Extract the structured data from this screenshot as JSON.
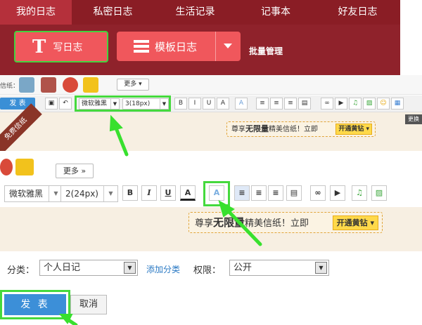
{
  "nav": {
    "tabs": [
      "我的日志",
      "私密日志",
      "生活记录",
      "记事本",
      "好友日志"
    ]
  },
  "actions": {
    "write": "写日志",
    "write_icon_glyph": "T",
    "template": "模板日志",
    "batch": "批量管理"
  },
  "small_editor": {
    "sticker_label": "信纸：",
    "more": "更多 ▾",
    "send": "发 表",
    "font": "微软雅黑",
    "size": "3(18px)",
    "format_glyphs": [
      "B",
      "I",
      "U",
      "A"
    ],
    "stamp": "免费信纸",
    "change": "更换",
    "promo_pre": "尊享",
    "promo_bold": "无限量",
    "promo_post": "精美信纸！立即",
    "vip": "开通黄钻 ▾"
  },
  "big_editor": {
    "more": "更多 »",
    "font": "微软雅黑",
    "size": "2(24px)",
    "format_glyphs": [
      "B",
      "I",
      "U",
      "A",
      "A"
    ],
    "promo_pre": "尊享",
    "promo_bold": "无限量",
    "promo_post": "精美信纸！立即",
    "vip": "开通黄钻 ▾"
  },
  "form": {
    "category_label": "分类：",
    "category_value": "个人日记",
    "add_category": "添加分类",
    "permission_label": "权限：",
    "permission_value": "公开",
    "publish": "发 表",
    "cancel": "取消"
  },
  "colors": {
    "highlight": "#45d93d",
    "brand": "#8e1e27",
    "button": "#f0575c",
    "link": "#2a79c4"
  }
}
